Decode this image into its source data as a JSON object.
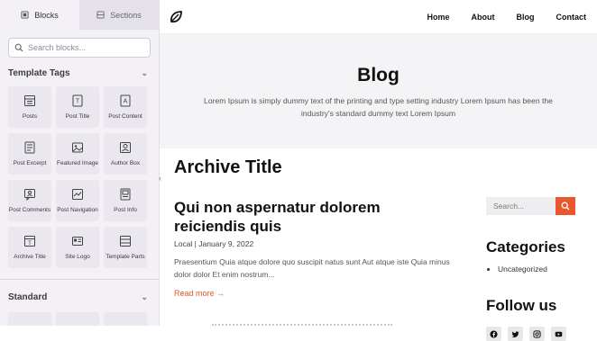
{
  "sidebar": {
    "tabs": [
      {
        "label": "Blocks",
        "icon": "blocks-icon"
      },
      {
        "label": "Sections",
        "icon": "sections-icon"
      }
    ],
    "search_placeholder": "Search blocks...",
    "template_tags_title": "Template Tags",
    "template_blocks": [
      {
        "label": "Posts",
        "icon": "posts-icon"
      },
      {
        "label": "Post Title",
        "icon": "post-title-icon"
      },
      {
        "label": "Post Content",
        "icon": "post-content-icon"
      },
      {
        "label": "Post Excerpt",
        "icon": "post-excerpt-icon"
      },
      {
        "label": "Featured Image",
        "icon": "featured-image-icon"
      },
      {
        "label": "Author Box",
        "icon": "author-box-icon"
      },
      {
        "label": "Post Comments",
        "icon": "post-comments-icon"
      },
      {
        "label": "Post Navigation",
        "icon": "post-navigation-icon"
      },
      {
        "label": "Post Info",
        "icon": "post-info-icon"
      },
      {
        "label": "Archive Title",
        "icon": "archive-title-icon"
      },
      {
        "label": "Site Logo",
        "icon": "site-logo-icon"
      },
      {
        "label": "Template Parts",
        "icon": "template-parts-icon"
      }
    ],
    "standard_title": "Standard"
  },
  "header": {
    "nav": [
      "Home",
      "About",
      "Blog",
      "Contact"
    ]
  },
  "hero": {
    "title": "Blog",
    "subtitle": "Lorem Ipsum is simply dummy text of the printing and type setting industry Lorem Ipsum has been the industry's standard dummy text Lorem Ipsum"
  },
  "content": {
    "archive_title": "Archive Title",
    "post_title": "Qui non aspernatur dolorem reiciendis quis",
    "post_meta": "Local | January 9, 2022",
    "excerpt": "Praesentium Quia atque dolore quo suscipit natus sunt Aut atque iste Quia minus dolor dolor Et enim nostrum...",
    "read_more": "Read more →"
  },
  "widgets": {
    "search_placeholder": "Search...",
    "categories_title": "Categories",
    "categories": [
      "Uncategorized"
    ],
    "follow_title": "Follow us",
    "socials": [
      "facebook-icon",
      "twitter-icon",
      "instagram-icon",
      "youtube-icon"
    ]
  },
  "colors": {
    "accent": "#e8572e",
    "sidebar_bg": "#f3f1f6",
    "hero_bg": "#f4f4f6"
  }
}
